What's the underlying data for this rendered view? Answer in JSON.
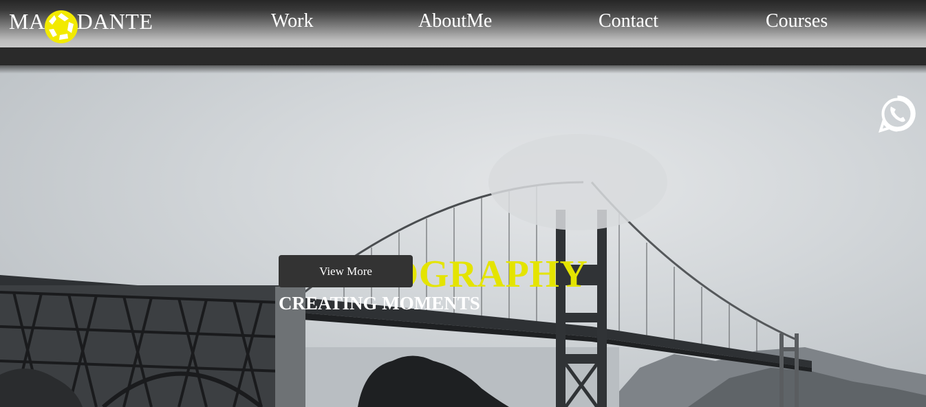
{
  "brand": {
    "name_left": "MA",
    "name_right": "DANTE",
    "logo_icon": "aperture-icon",
    "accent_color": "#f2ea00"
  },
  "nav": {
    "items": [
      {
        "label": "Work"
      },
      {
        "label": "AboutMe"
      },
      {
        "label": "Contact"
      },
      {
        "label": "Courses"
      }
    ]
  },
  "hero": {
    "headline": "PHOTOGRAPHY",
    "subheadline": "CREATING MOMENTS",
    "cta_label": "View More",
    "background": "golden-gate-bridge-fog-grayscale",
    "headline_color": "#e4e400"
  },
  "floating": {
    "whatsapp_icon": "whatsapp-icon"
  }
}
